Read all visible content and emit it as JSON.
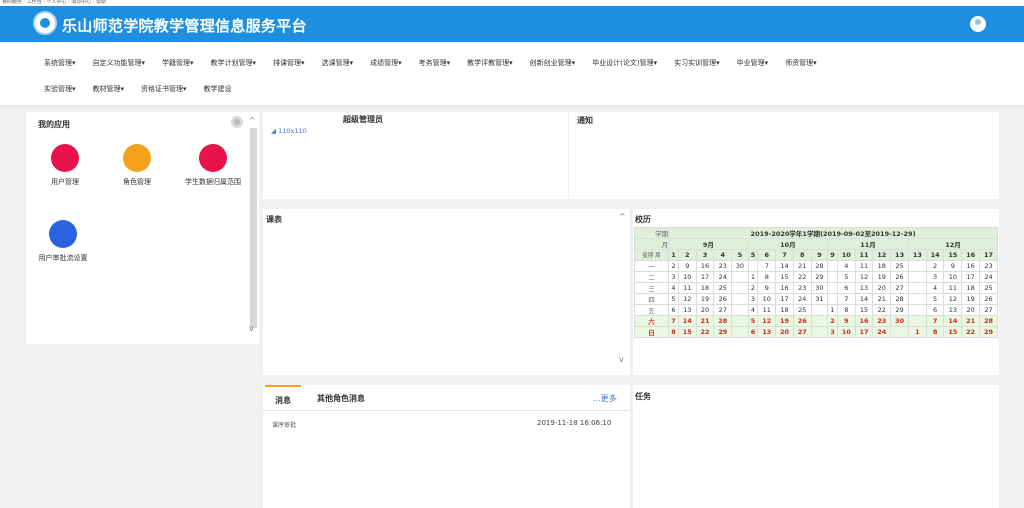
{
  "topbar": {
    "text": "我的服务 · 工作台 · 个人中心 · 消息中心 · 帮助"
  },
  "header": {
    "title": "乐山师范学院教学管理信息服务平台"
  },
  "nav": {
    "row1": [
      "系统管理▾",
      "自定义功能管理▾",
      "学籍管理▾",
      "教学计划管理▾",
      "排课管理▾",
      "选课管理▾",
      "成绩管理▾",
      "考务管理▾",
      "教学评教管理▾",
      "创新创业管理▾",
      "毕业设计(论文)管理▾",
      "实习实训管理▾",
      "毕业管理▾",
      "师资管理▾"
    ],
    "row2": [
      "实验管理▾",
      "教材管理▾",
      "资格证书管理▾",
      "教学建设"
    ]
  },
  "apps": {
    "title": "我的应用",
    "items": [
      "用户管理",
      "角色管理",
      "学生数据归属范围",
      "用户审批流设置"
    ]
  },
  "admin": {
    "title": "超级管理员",
    "link": "110x110"
  },
  "notice": {
    "title": "通知"
  },
  "schedule": {
    "title": "课表"
  },
  "calendar": {
    "title": "校历",
    "xueqi_label": "学期",
    "yue_label": "月",
    "zhou_label": "周",
    "xingqi_label": "星期",
    "semester": "2019-2020学年1学期(2019-09-02至2019-12-29)",
    "months": [
      "9月",
      "10月",
      "11月",
      "12月"
    ],
    "weeks": [
      "1",
      "2",
      "3",
      "4",
      "5",
      "5",
      "6",
      "7",
      "8",
      "9",
      "9",
      "10",
      "11",
      "12",
      "13",
      "13",
      "14",
      "15",
      "16",
      "17"
    ],
    "rows": [
      {
        "day": "一",
        "v": [
          "2",
          "9",
          "16",
          "23",
          "30",
          "",
          "7",
          "14",
          "21",
          "28",
          "",
          "4",
          "11",
          "18",
          "25",
          "",
          "2",
          "9",
          "16",
          "23"
        ]
      },
      {
        "day": "二",
        "v": [
          "3",
          "10",
          "17",
          "24",
          "",
          "1",
          "8",
          "15",
          "22",
          "29",
          "",
          "5",
          "12",
          "19",
          "26",
          "",
          "3",
          "10",
          "17",
          "24"
        ]
      },
      {
        "day": "三",
        "v": [
          "4",
          "11",
          "18",
          "25",
          "",
          "2",
          "9",
          "16",
          "23",
          "30",
          "",
          "6",
          "13",
          "20",
          "27",
          "",
          "4",
          "11",
          "18",
          "25"
        ]
      },
      {
        "day": "四",
        "v": [
          "5",
          "12",
          "19",
          "26",
          "",
          "3",
          "10",
          "17",
          "24",
          "31",
          "",
          "7",
          "14",
          "21",
          "28",
          "",
          "5",
          "12",
          "19",
          "26"
        ]
      },
      {
        "day": "五",
        "v": [
          "6",
          "13",
          "20",
          "27",
          "",
          "4",
          "11",
          "18",
          "25",
          "",
          "1",
          "8",
          "15",
          "22",
          "29",
          "",
          "6",
          "13",
          "20",
          "27"
        ]
      },
      {
        "day": "六",
        "v": [
          "7",
          "14",
          "21",
          "28",
          "",
          "5",
          "12",
          "19",
          "26",
          "",
          "2",
          "9",
          "16",
          "23",
          "30",
          "",
          "7",
          "14",
          "21",
          "28"
        ],
        "weekend": true
      },
      {
        "day": "日",
        "v": [
          "8",
          "15",
          "22",
          "29",
          "",
          "6",
          "13",
          "20",
          "27",
          "",
          "3",
          "10",
          "17",
          "24",
          "",
          "1",
          "8",
          "15",
          "22",
          "29"
        ],
        "weekend": true
      }
    ]
  },
  "messages": {
    "tab1": "消息",
    "tab2": "其他角色消息",
    "more": "...更多",
    "item": {
      "text": "课序审批",
      "time": "2019-11-18 16:06:10"
    }
  },
  "tasks": {
    "title": "任务"
  },
  "colors": {
    "header": "#1e8fe0",
    "app1": "#e8134a",
    "app2": "#f4a21a",
    "app3": "#e8134a",
    "app4": "#2b62e0",
    "weekend": "#d9251c"
  }
}
